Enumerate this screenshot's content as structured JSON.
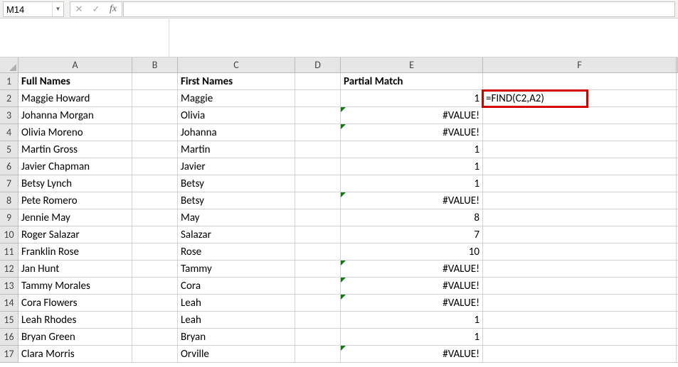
{
  "formula_bar": {
    "cell_ref": "M14",
    "cancel_glyph": "✕",
    "confirm_glyph": "✓",
    "fx_label": "fx",
    "formula_value": ""
  },
  "columns": [
    "A",
    "B",
    "C",
    "D",
    "E",
    "F"
  ],
  "chart_data": {
    "type": "table",
    "title": "",
    "headers": {
      "A": "Full Names",
      "C": "First Names",
      "E": "Partial Match"
    },
    "rows": [
      {
        "row": 2,
        "A": "Maggie Howard",
        "C": "Maggie",
        "E": "1",
        "F": "=FIND(C2,A2)",
        "E_err": false
      },
      {
        "row": 3,
        "A": "Johanna Morgan",
        "C": "Olivia",
        "E": "#VALUE!",
        "E_err": true
      },
      {
        "row": 4,
        "A": "Olivia Moreno",
        "C": "Johanna",
        "E": "#VALUE!",
        "E_err": true
      },
      {
        "row": 5,
        "A": "Martin Gross",
        "C": "Martin",
        "E": "1",
        "E_err": false
      },
      {
        "row": 6,
        "A": "Javier Chapman",
        "C": "Javier",
        "E": "1",
        "E_err": false
      },
      {
        "row": 7,
        "A": "Betsy Lynch",
        "C": "Betsy",
        "E": "1",
        "E_err": false
      },
      {
        "row": 8,
        "A": "Pete Romero",
        "C": "Betsy",
        "E": "#VALUE!",
        "E_err": true
      },
      {
        "row": 9,
        "A": "Jennie May",
        "C": "May",
        "E": "8",
        "E_err": false
      },
      {
        "row": 10,
        "A": "Roger Salazar",
        "C": "Salazar",
        "E": "7",
        "E_err": false
      },
      {
        "row": 11,
        "A": "Franklin Rose",
        "C": "Rose",
        "E": "10",
        "E_err": false
      },
      {
        "row": 12,
        "A": "Jan Hunt",
        "C": "Tammy",
        "E": "#VALUE!",
        "E_err": true
      },
      {
        "row": 13,
        "A": "Tammy Morales",
        "C": "Cora",
        "E": "#VALUE!",
        "E_err": true
      },
      {
        "row": 14,
        "A": "Cora Flowers",
        "C": "Leah",
        "E": "#VALUE!",
        "E_err": true
      },
      {
        "row": 15,
        "A": "Leah Rhodes",
        "C": "Leah",
        "E": "1",
        "E_err": false
      },
      {
        "row": 16,
        "A": "Bryan Green",
        "C": "Bryan",
        "E": "1",
        "E_err": false
      },
      {
        "row": 17,
        "A": "Clara Morris",
        "C": "Orville",
        "E": "#VALUE!",
        "E_err": true
      }
    ]
  },
  "highlight": {
    "cell": "F2"
  }
}
